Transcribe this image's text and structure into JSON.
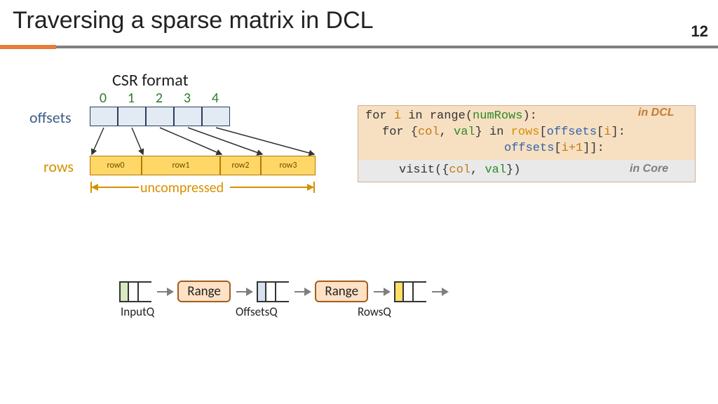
{
  "title": "Traversing a sparse matrix in DCL",
  "pagenum": "12",
  "csr": {
    "heading": "CSR format",
    "indices": [
      "0",
      "1",
      "2",
      "3",
      "4"
    ],
    "offsets_label": "offsets",
    "rows_label": "rows",
    "rows": [
      "row0",
      "row1",
      "row2",
      "row3"
    ],
    "uncompressed": "uncompressed"
  },
  "code": {
    "in_dcl": "in DCL",
    "in_core": "in Core",
    "l1_for": "for ",
    "l1_i": "i",
    "l1_in": " in ",
    "l1_range": "range(",
    "l1_numrows": "numRows",
    "l1_close": "):",
    "l2_for": "for {",
    "l2_col": "col",
    "l2_sep": ", ",
    "l2_val": "val",
    "l2_in": "} in ",
    "l2_rows": "rows",
    "l2_br": "[",
    "l2_off": "offsets",
    "l2_idx": "[",
    "l2_i": "i",
    "l2_idx2": "]:",
    "l3_off": "offsets",
    "l3_idx": "[",
    "l3_i": "i+1",
    "l3_close": "]]:",
    "l4_pre": "visit({",
    "l4_col": "col",
    "l4_sep": ", ",
    "l4_val": "val",
    "l4_post": "})"
  },
  "pipe": {
    "inputq": "InputQ",
    "offsetsq": "OffsetsQ",
    "rowsq": "RowsQ",
    "range": "Range"
  }
}
